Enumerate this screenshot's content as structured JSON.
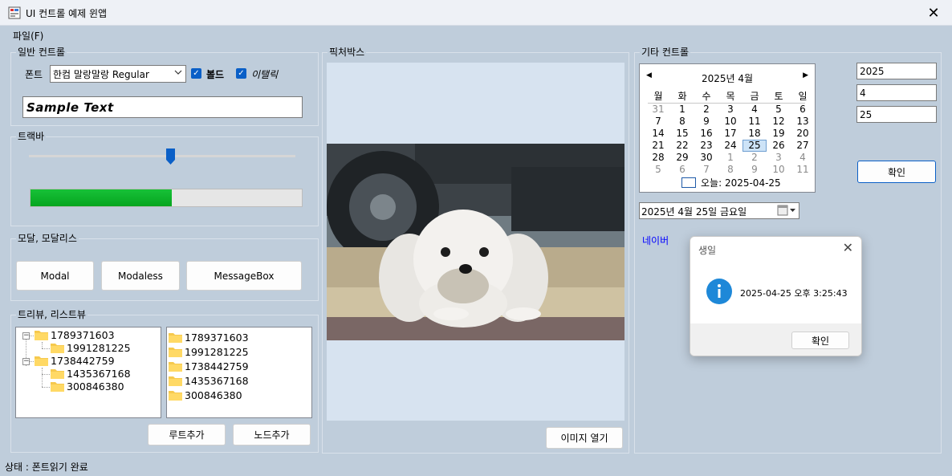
{
  "window": {
    "title": "UI 컨트롤 예제 윈앱",
    "close_glyph": "✕"
  },
  "menu": {
    "file": "파일(F)"
  },
  "general": {
    "label": "일반 컨트롤",
    "font_label": "폰트",
    "font_value": "한컴 말랑말랑 Regular",
    "bold_label": "볼드",
    "bold_checked": true,
    "italic_label": "이탤릭",
    "italic_checked": true,
    "sample_text": "Sample Text"
  },
  "trackbar": {
    "label": "트랙바",
    "value_fraction": 0.52,
    "progress_fraction": 0.52
  },
  "modal": {
    "label": "모달, 모달리스",
    "buttons": [
      "Modal",
      "Modaless",
      "MessageBox"
    ]
  },
  "treeview": {
    "label": "트리뷰, 리스트뷰",
    "tree": [
      {
        "text": "1789371603",
        "children": [
          "1991281225"
        ]
      },
      {
        "text": "1738442759",
        "children": [
          "1435367168",
          "300846380"
        ]
      }
    ],
    "list": [
      "1789371603",
      "1991281225",
      "1738442759",
      "1435367168",
      "300846380"
    ],
    "add_root": "루트추가",
    "add_node": "노드추가"
  },
  "picture": {
    "label": "픽처박스",
    "open_button": "이미지 열기"
  },
  "etc": {
    "label": "기타 컨트롤",
    "calendar": {
      "month_label": "2025년 4월",
      "weekdays": [
        "월",
        "화",
        "수",
        "목",
        "금",
        "토",
        "일"
      ],
      "weeks": [
        [
          "31",
          "1",
          "2",
          "3",
          "4",
          "5",
          "6"
        ],
        [
          "7",
          "8",
          "9",
          "10",
          "11",
          "12",
          "13"
        ],
        [
          "14",
          "15",
          "16",
          "17",
          "18",
          "19",
          "20"
        ],
        [
          "21",
          "22",
          "23",
          "24",
          "25",
          "26",
          "27"
        ],
        [
          "28",
          "29",
          "30",
          "1",
          "2",
          "3",
          "4"
        ],
        [
          "5",
          "6",
          "7",
          "8",
          "9",
          "10",
          "11"
        ]
      ],
      "selected": "25",
      "today_label": "오늘: 2025-04-25"
    },
    "year": "2025",
    "month": "4",
    "day": "25",
    "confirm": "확인",
    "datetime_value": "2025년   4월 25일 금요일",
    "link": "네이버"
  },
  "messagebox": {
    "title": "생일",
    "text": "2025-04-25 오후 3:25:43",
    "ok": "확인"
  },
  "status": "상태 : 폰트읽기 완료",
  "colors": {
    "accent": "#0a5fc7",
    "progress": "#06a51f",
    "info_icon": "#1e88d8",
    "link": "#0000ff"
  }
}
